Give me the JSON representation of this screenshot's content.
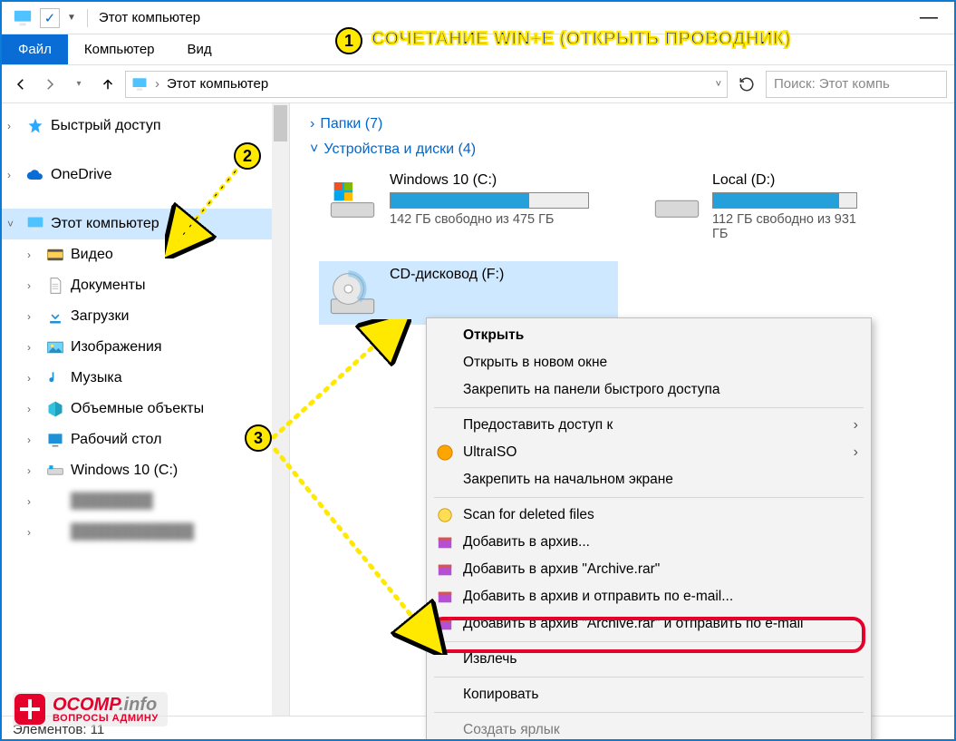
{
  "titlebar": {
    "title": "Этот компьютер"
  },
  "ribbon": {
    "file": "Файл",
    "computer": "Компьютер",
    "view": "Вид"
  },
  "nav": {
    "breadcrumb_root": "Этот компьютер",
    "search_placeholder": "Поиск: Этот компь"
  },
  "sidebar": {
    "quick_access": "Быстрый доступ",
    "onedrive": "OneDrive",
    "this_pc": "Этот компьютер",
    "video": "Видео",
    "documents": "Документы",
    "downloads": "Загрузки",
    "pictures": "Изображения",
    "music": "Музыка",
    "objects3d": "Объемные объекты",
    "desktop": "Рабочий стол",
    "drive_c": "Windows 10 (C:)"
  },
  "main": {
    "group_folders": "Папки (7)",
    "group_devices": "Устройства и диски (4)",
    "drive_c": {
      "name": "Windows 10 (C:)",
      "sub": "142 ГБ свободно из 475 ГБ",
      "fill_pct": 70
    },
    "drive_d": {
      "name": "Local (D:)",
      "sub": "112 ГБ свободно из 931 ГБ",
      "fill_pct": 88
    },
    "drive_f": {
      "name": "CD-дисковод (F:)"
    }
  },
  "ctx": {
    "open": "Открыть",
    "open_new": "Открыть в новом окне",
    "pin_quick": "Закрепить на панели быстрого доступа",
    "share": "Предоставить доступ к",
    "ultraiso": "UltraISO",
    "pin_start": "Закрепить на начальном экране",
    "scan_deleted": "Scan for deleted files",
    "add_archive": "Добавить в архив...",
    "add_archive_rar": "Добавить в архив \"Archive.rar\"",
    "add_email": "Добавить в архив и отправить по e-mail...",
    "add_rar_email": "Добавить в архив \"Archive.rar\" и отправить по e-mail",
    "eject": "Извлечь",
    "copy": "Копировать",
    "create_shortcut": "Создать ярлык"
  },
  "status": {
    "items": "Элементов: 11"
  },
  "annotation": {
    "tip1": "СОЧЕТАНИЕ WIN+E   (ОТКРЫТЬ ПРОВОДНИК)",
    "logo_main": "OCOMP",
    "logo_suffix": ".info",
    "logo_sub": "ВОПРОСЫ АДМИНУ"
  }
}
